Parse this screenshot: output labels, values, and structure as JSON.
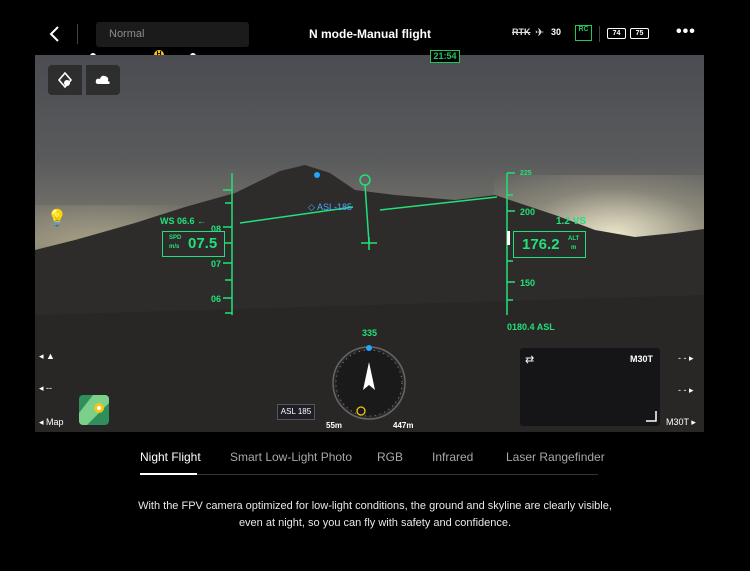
{
  "header": {
    "back_icon": "back-chevron-icon",
    "mode": "Normal",
    "title": "N mode-Manual flight",
    "rtk_label": "RTK",
    "satellite_count": "30",
    "rc_label": "RC",
    "battery_1": "74",
    "battery_2": "75",
    "more_icon": "more-dots-icon"
  },
  "progress": {
    "home_marker": "H",
    "remaining_time": "21:54",
    "colors": {
      "low": "#e53935",
      "mid": "#f59e0b",
      "ok": "#22c55e"
    }
  },
  "hud": {
    "wind": "WS 06.6 ←",
    "speed_label": "SPD",
    "speed_unit": "m/s",
    "speed_value": "07.5",
    "speed_ticks": [
      "08",
      "07",
      "06"
    ],
    "asl_marker": "ASL-185",
    "vertical_speed": "1.2  VS",
    "alt_label": "ALT",
    "alt_unit": "m",
    "alt_value": "176.2",
    "alt_ticks": [
      "225",
      "200",
      "150"
    ],
    "asl_readout": "0180.4 ASL",
    "heading": "335",
    "home_distance": "55m",
    "target_distance": "447m",
    "asl_badge": "ASL 185"
  },
  "side": {
    "left_labels": [
      "--",
      "Map"
    ],
    "right_labels": [
      "- -",
      "- -",
      "M30T"
    ],
    "minimap_label": "M30T"
  },
  "tabs": [
    {
      "label": "Night Flight",
      "active": true
    },
    {
      "label": "Smart Low-Light Photo",
      "active": false
    },
    {
      "label": "RGB",
      "active": false
    },
    {
      "label": "Infrared",
      "active": false
    },
    {
      "label": "Laser Rangefinder",
      "active": false
    }
  ],
  "description": {
    "line1": "With the FPV camera optimized for low-light conditions, the ground and skyline are clearly visible,",
    "line2": "even at night, so you can fly with safety and confidence."
  },
  "colors": {
    "hud_green": "#22e07a",
    "accent": "#22c55e"
  }
}
